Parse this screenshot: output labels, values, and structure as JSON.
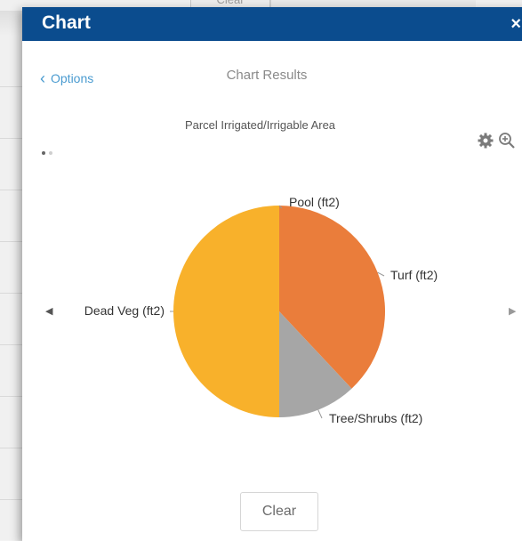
{
  "background": {
    "tab_label": "Clear"
  },
  "panel": {
    "title": "Chart",
    "close_glyph": "×",
    "options_label": "Options",
    "results_title": "Chart Results",
    "clear_label": "Clear"
  },
  "colors": {
    "titlebar": "#0b4c8e",
    "turf": "#ea7d3b",
    "tree_shrubs": "#a6a6a6",
    "dead_veg": "#f8b12b",
    "pool": "#f0c020"
  },
  "icons": [
    "chevron-left-icon",
    "gear-icon",
    "zoom-in-icon",
    "arrow-left-icon",
    "arrow-right-icon",
    "close-icon"
  ],
  "chart_data": {
    "type": "pie",
    "title": "Parcel Irrigated/Irrigable Area",
    "categories": [
      "Pool (ft2)",
      "Turf (ft2)",
      "Tree/Shrubs (ft2)",
      "Dead Veg (ft2)"
    ],
    "values": [
      0,
      38,
      12,
      50
    ],
    "legend": "none"
  }
}
